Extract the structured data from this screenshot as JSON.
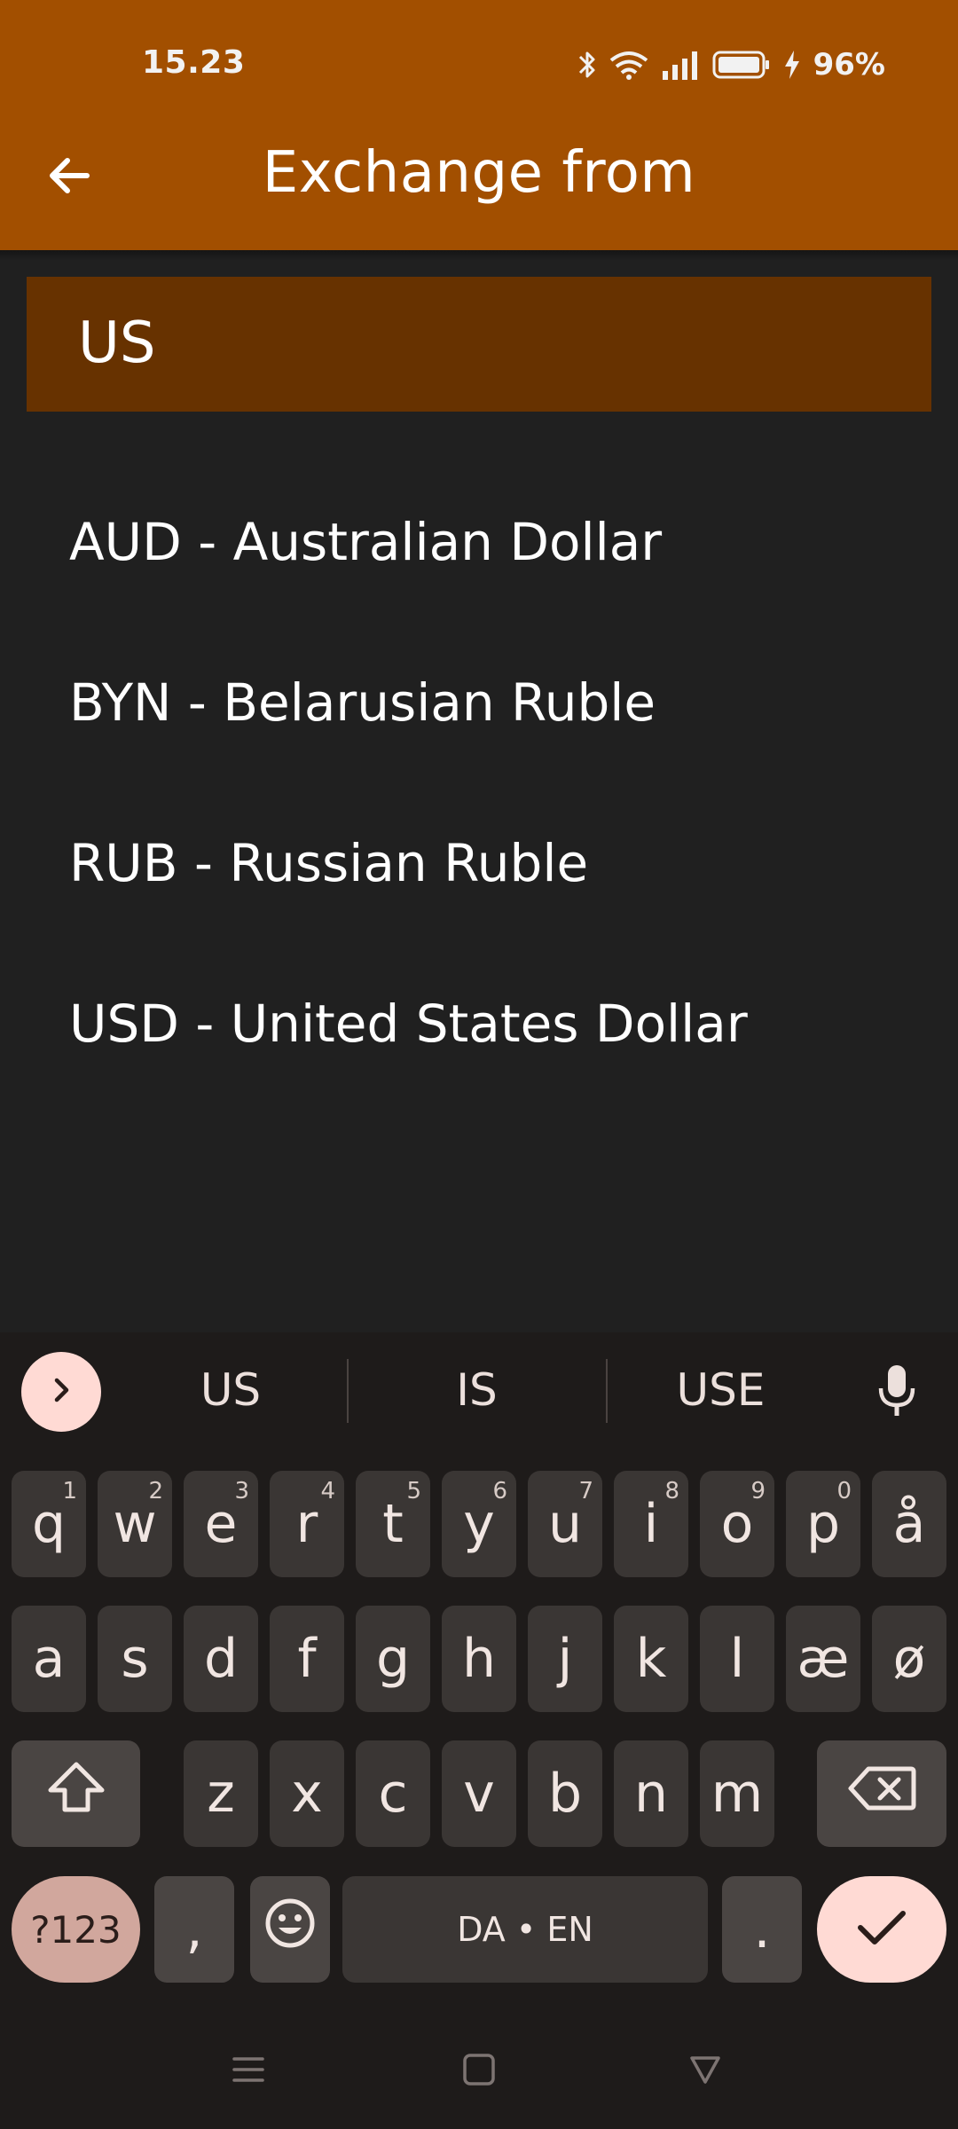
{
  "status_bar": {
    "time": "15.23",
    "battery_percent": "96%",
    "icons": [
      "bluetooth-icon",
      "wifi-icon",
      "signal-icon",
      "battery-icon",
      "charging-icon"
    ]
  },
  "app_bar": {
    "title": "Exchange from",
    "back_icon": "arrow-left-icon",
    "background_color": "#a24f00"
  },
  "search": {
    "value": "US",
    "background_color": "#673200"
  },
  "currency_list": [
    {
      "label": "AUD - Australian Dollar"
    },
    {
      "label": "BYN - Belarusian Ruble"
    },
    {
      "label": "RUB - Russian Ruble"
    },
    {
      "label": "USD - United States Dollar"
    }
  ],
  "keyboard": {
    "suggestions": [
      "US",
      "IS",
      "USE"
    ],
    "row1": [
      {
        "key": "q",
        "hint": "1"
      },
      {
        "key": "w",
        "hint": "2"
      },
      {
        "key": "e",
        "hint": "3"
      },
      {
        "key": "r",
        "hint": "4"
      },
      {
        "key": "t",
        "hint": "5"
      },
      {
        "key": "y",
        "hint": "6"
      },
      {
        "key": "u",
        "hint": "7"
      },
      {
        "key": "i",
        "hint": "8"
      },
      {
        "key": "o",
        "hint": "9"
      },
      {
        "key": "p",
        "hint": "0"
      },
      {
        "key": "å",
        "hint": ""
      }
    ],
    "row2": [
      "a",
      "s",
      "d",
      "f",
      "g",
      "h",
      "j",
      "k",
      "l",
      "æ",
      "ø"
    ],
    "row3": [
      "z",
      "x",
      "c",
      "v",
      "b",
      "n",
      "m"
    ],
    "symbols_label": "?123",
    "comma_label": ",",
    "space_label": "DA • EN",
    "period_label": ".",
    "icons": [
      "chevron-right-icon",
      "microphone-icon",
      "shift-icon",
      "backspace-icon",
      "emoji-icon",
      "checkmark-icon"
    ]
  },
  "nav_bar": {
    "icons": [
      "menu-icon",
      "home-icon",
      "back-triangle-icon"
    ]
  }
}
